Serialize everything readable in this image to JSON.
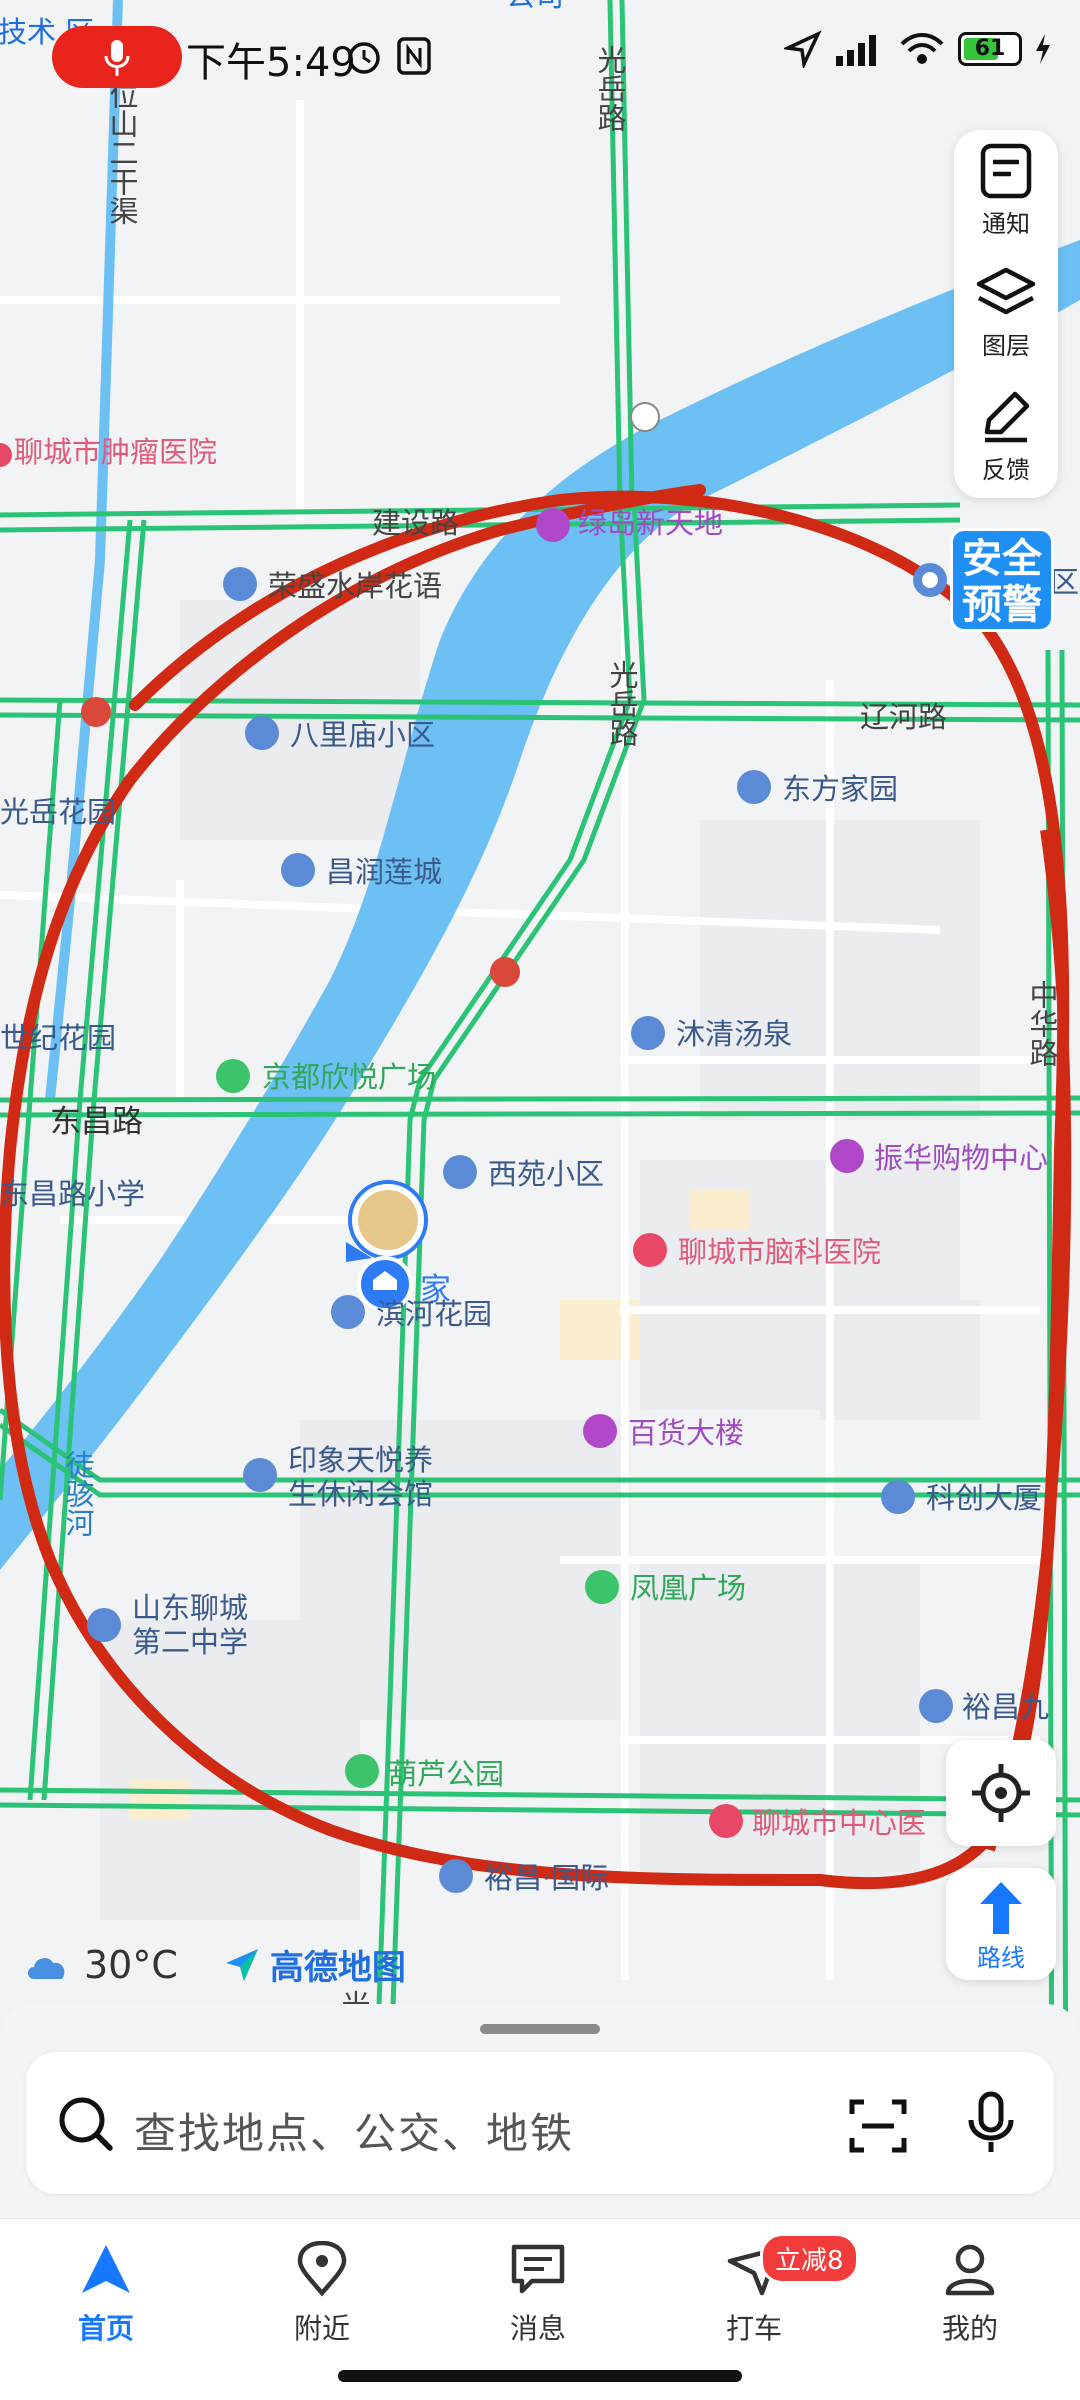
{
  "status": {
    "time": "下午5:49",
    "battery": "61"
  },
  "map_labels": {
    "top_left_clip": "技术\n区",
    "tumor_hospital": "聊城市肿瘤医院",
    "jianshe_road": "建设路",
    "lvdao": "绿岛新天地",
    "lyyuan": "荣盛水岸花语",
    "balimiao": "八里庙小区",
    "guangyue_garden": "光岳花园",
    "changrun": "昌润莲城",
    "shiji": "世纪花园",
    "dongchang_road": "东昌路",
    "dongchang_school": "东昌路小学",
    "jingdu": "京都欣悦广场",
    "xiyuan": "西苑小区",
    "home": "家",
    "binhe": "滨河花园",
    "yinxiang_1": "印象天悦养",
    "yinxiang_2": "生休闲会馆",
    "shandong_1": "山东聊城",
    "shandong_2": "第二中学",
    "hulu": "葫芦公园",
    "yuchang": "裕昌·国际",
    "guangyue_road": "光岳路",
    "guangyue_road_top": "光岳路",
    "guangyue_road_bottom": "光岳路",
    "liaohe_road": "辽河路",
    "dongfang": "东方家园",
    "muqing": "沐清汤泉",
    "zhenhua": "振华购物中心",
    "brain_hospital": "聊城市脑科医院",
    "baihuo": "百货大楼",
    "kechuang": "科创大厦",
    "fenghuang": "凤凰广场",
    "yuchang_right": "裕昌九",
    "center_hospital": "聊城市中心医",
    "canal": "位山二干渠",
    "river": "徒骇河",
    "company": "公司",
    "zhonghua": "中华路",
    "right_clip": "区"
  },
  "side_tools": [
    {
      "label": "通知",
      "icon": "notification-icon"
    },
    {
      "label": "图层",
      "icon": "layers-icon"
    },
    {
      "label": "反馈",
      "icon": "feedback-icon"
    }
  ],
  "safety_badge": {
    "line1": "安全",
    "line2": "预警"
  },
  "route_button": {
    "label": "路线"
  },
  "weather": {
    "temp": "30°C",
    "brand": "高德地图"
  },
  "search": {
    "placeholder": "查找地点、公交、地铁"
  },
  "tabs": [
    {
      "label": "首页",
      "icon": "home-nav-icon",
      "active": true
    },
    {
      "label": "附近",
      "icon": "location-pin-icon",
      "active": false
    },
    {
      "label": "消息",
      "icon": "message-icon",
      "active": false
    },
    {
      "label": "打车",
      "icon": "taxi-icon",
      "active": false,
      "badge": "立减8"
    },
    {
      "label": "我的",
      "icon": "profile-icon",
      "active": false
    }
  ],
  "colors": {
    "accent": "#1677ff",
    "road": "#2bc375",
    "river": "#6cc0f4",
    "annotation": "#d02a14"
  }
}
